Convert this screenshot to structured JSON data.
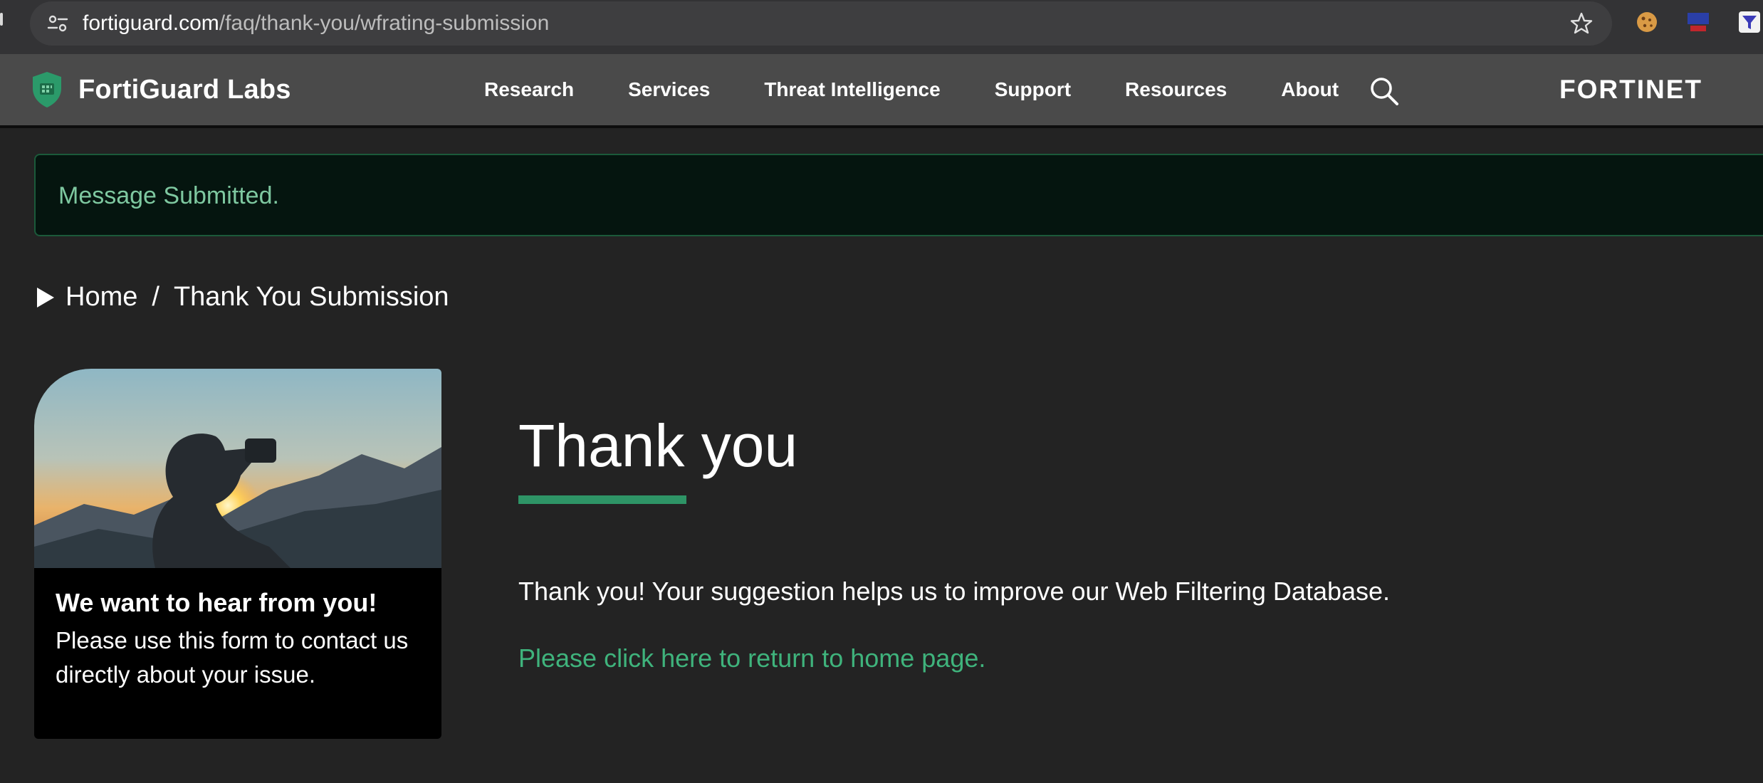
{
  "browser": {
    "url_host": "fortiguard.com",
    "url_path": "/faq/thank-you/wfrating-submission"
  },
  "header": {
    "brand": "FortiGuard Labs",
    "nav": [
      "Research",
      "Services",
      "Threat Intelligence",
      "Support",
      "Resources",
      "About"
    ],
    "logo": "FORTINET"
  },
  "alert": {
    "message": "Message Submitted."
  },
  "breadcrumb": {
    "home": "Home",
    "separator": "/",
    "current": "Thank You Submission"
  },
  "card": {
    "title": "We want to hear from you!",
    "body": "Please use this form to contact us directly about your issue."
  },
  "main": {
    "title": "Thank you",
    "message": "Thank you! Your suggestion helps us to improve our Web Filtering Database.",
    "link": "Please click here to return to home page."
  },
  "colors": {
    "accent": "#2e9466",
    "link": "#3fb37c",
    "alert_text": "#7ec8a0",
    "background": "#232323",
    "header": "#4a4a4a"
  },
  "icons": {
    "site_info": "tune-icon",
    "bookmark": "star-icon",
    "search": "search-icon",
    "breadcrumb": "play-icon",
    "brand": "shield-icon"
  }
}
